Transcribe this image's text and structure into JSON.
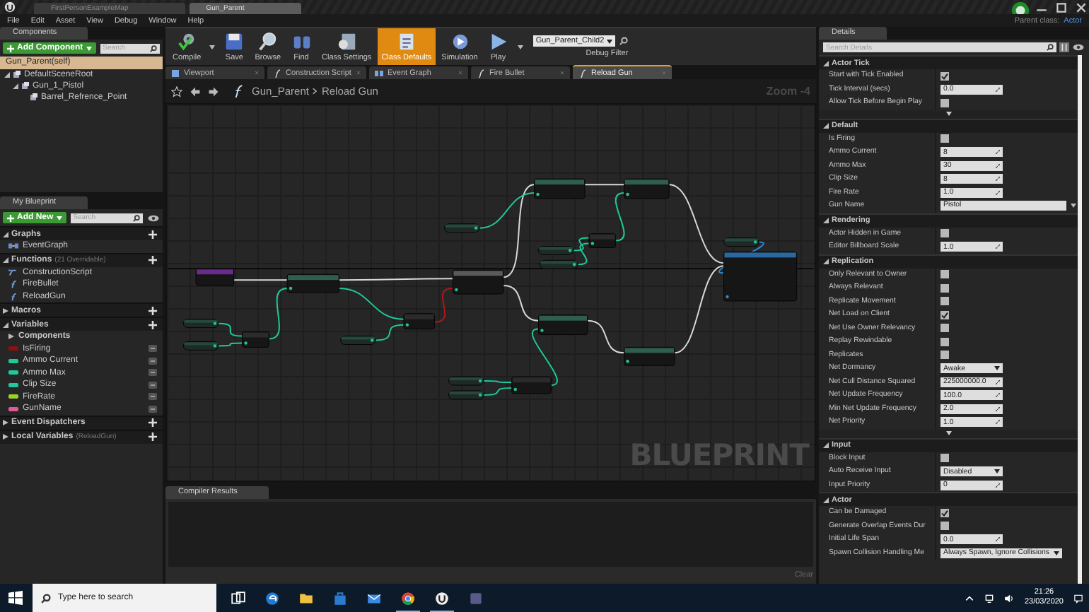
{
  "window": {
    "tabs": [
      {
        "label": "FirstPersonExampleMap",
        "selected": false
      },
      {
        "label": "Gun_Parent",
        "selected": true
      }
    ]
  },
  "menu": [
    "File",
    "Edit",
    "Asset",
    "View",
    "Debug",
    "Window",
    "Help"
  ],
  "parent_class": {
    "label": "Parent class:",
    "value": "Actor"
  },
  "components": {
    "title": "Components",
    "add_button": "Add Component",
    "search_placeholder": "Search",
    "self_row": {
      "label": "Gun_Parent(self)",
      "selected": true
    },
    "tree": [
      {
        "label": "DefaultSceneRoot",
        "expanded": true,
        "children": [
          {
            "label": "Gun_1_Pistol",
            "expanded": true,
            "children": [
              {
                "label": "Barrel_Refrence_Point"
              }
            ]
          }
        ]
      }
    ]
  },
  "my_blueprint": {
    "title": "My Blueprint",
    "add_button": "Add New",
    "search_placeholder": "Search",
    "sections": [
      {
        "label": "Graphs",
        "expanded": true,
        "items": [
          {
            "label": "EventGraph",
            "kind": "graph"
          }
        ]
      },
      {
        "label": "Functions",
        "note": "(21 Overridable)",
        "expanded": true,
        "items": [
          {
            "label": "ConstructionScript",
            "kind": "construction"
          },
          {
            "label": "FireBullet",
            "kind": "function"
          },
          {
            "label": "ReloadGun",
            "kind": "function"
          }
        ]
      },
      {
        "label": "Macros",
        "expanded": false
      },
      {
        "label": "Variables",
        "expanded": true,
        "items": [
          {
            "label": "Components",
            "kind": "category"
          },
          {
            "label": "IsFiring",
            "kind": "variable",
            "color": "#8c1010"
          },
          {
            "label": "Ammo Current",
            "kind": "variable",
            "color": "#1fc99a"
          },
          {
            "label": "Ammo Max",
            "kind": "variable",
            "color": "#1fc99a"
          },
          {
            "label": "Clip Size",
            "kind": "variable",
            "color": "#1fc99a"
          },
          {
            "label": "FireRate",
            "kind": "variable",
            "color": "#9ad12a"
          },
          {
            "label": "GunName",
            "kind": "variable",
            "color": "#e05a9a"
          }
        ]
      },
      {
        "label": "Event Dispatchers",
        "expanded": false
      },
      {
        "label": "Local Variables",
        "note": "(ReloadGun)",
        "expanded": false
      }
    ]
  },
  "toolbar": {
    "buttons": [
      {
        "label": "Compile",
        "kind": "compile",
        "selected": false,
        "menu": true
      },
      {
        "label": "Save",
        "kind": "save",
        "selected": false,
        "menu": false
      },
      {
        "label": "Browse",
        "kind": "browse",
        "selected": false,
        "menu": false
      },
      {
        "label": "Find",
        "kind": "find",
        "selected": false,
        "menu": false
      },
      {
        "label": "Class Settings",
        "kind": "settings",
        "selected": false,
        "menu": false
      },
      {
        "label": "Class Defaults",
        "kind": "defaults",
        "selected": true,
        "menu": false
      },
      {
        "label": "Simulation",
        "kind": "simulation",
        "selected": false,
        "menu": false
      },
      {
        "label": "Play",
        "kind": "play",
        "selected": false,
        "menu": true
      }
    ],
    "debug": {
      "value": "Gun_Parent_Child2",
      "label": "Debug Filter"
    }
  },
  "graph_tabs": [
    {
      "label": "Viewport",
      "kind": "viewport",
      "selected": false
    },
    {
      "label": "Construction Script",
      "kind": "function",
      "selected": false
    },
    {
      "label": "Event Graph",
      "kind": "graph",
      "selected": false
    },
    {
      "label": "Fire Bullet",
      "kind": "function",
      "selected": false
    },
    {
      "label": "Reload Gun",
      "kind": "function",
      "selected": true
    }
  ],
  "breadcrumb": {
    "root": "Gun_Parent",
    "current": "Reload Gun",
    "zoom": "Zoom -4"
  },
  "graph_badge": "BLUEPRINT",
  "compiler": {
    "title": "Compiler Results",
    "clear": "Clear"
  },
  "details": {
    "title": "Details",
    "search_placeholder": "Search Details",
    "sections": [
      {
        "label": "Actor Tick",
        "advanced": true,
        "rows": [
          {
            "label": "Start with Tick Enabled",
            "kind": "checkbox",
            "checked": true
          },
          {
            "label": "Tick Interval (secs)",
            "kind": "number",
            "value": "0.0"
          },
          {
            "label": "Allow Tick Before Begin Play",
            "kind": "checkbox",
            "checked": false
          }
        ]
      },
      {
        "label": "Default",
        "advanced": false,
        "rows": [
          {
            "label": "Is Firing",
            "kind": "checkbox",
            "checked": false
          },
          {
            "label": "Ammo Current",
            "kind": "number",
            "value": "8"
          },
          {
            "label": "Ammo Max",
            "kind": "number",
            "value": "30"
          },
          {
            "label": "Clip Size",
            "kind": "number",
            "value": "8"
          },
          {
            "label": "Fire Rate",
            "kind": "number",
            "value": "1.0"
          },
          {
            "label": "Gun Name",
            "kind": "text",
            "value": "Pistol"
          }
        ]
      },
      {
        "label": "Rendering",
        "advanced": false,
        "rows": [
          {
            "label": "Actor Hidden in Game",
            "kind": "checkbox",
            "checked": false
          },
          {
            "label": "Editor Billboard Scale",
            "kind": "number",
            "value": "1.0"
          }
        ]
      },
      {
        "label": "Replication",
        "advanced": true,
        "rows": [
          {
            "label": "Only Relevant to Owner",
            "kind": "checkbox",
            "checked": false
          },
          {
            "label": "Always Relevant",
            "kind": "checkbox",
            "checked": false
          },
          {
            "label": "Replicate Movement",
            "kind": "checkbox",
            "checked": false
          },
          {
            "label": "Net Load on Client",
            "kind": "checkbox",
            "checked": true
          },
          {
            "label": "Net Use Owner Relevancy",
            "kind": "checkbox",
            "checked": false
          },
          {
            "label": "Replay Rewindable",
            "kind": "checkbox",
            "checked": false
          },
          {
            "label": "Replicates",
            "kind": "checkbox",
            "checked": false
          },
          {
            "label": "Net Dormancy",
            "kind": "dropdown",
            "value": "Awake"
          },
          {
            "label": "Net Cull Distance Squared",
            "kind": "number",
            "value": "225000000.0"
          },
          {
            "label": "Net Update Frequency",
            "kind": "number",
            "value": "100.0"
          },
          {
            "label": "Min Net Update Frequency",
            "kind": "number",
            "value": "2.0"
          },
          {
            "label": "Net Priority",
            "kind": "number",
            "value": "1.0"
          }
        ]
      },
      {
        "label": "Input",
        "advanced": false,
        "rows": [
          {
            "label": "Block Input",
            "kind": "checkbox",
            "checked": false
          },
          {
            "label": "Auto Receive Input",
            "kind": "dropdown",
            "value": "Disabled"
          },
          {
            "label": "Input Priority",
            "kind": "number",
            "value": "0"
          }
        ]
      },
      {
        "label": "Actor",
        "advanced": false,
        "rows": [
          {
            "label": "Can be Damaged",
            "kind": "checkbox",
            "checked": true
          },
          {
            "label": "Generate Overlap Events Dur",
            "kind": "checkbox",
            "checked": false
          },
          {
            "label": "Initial Life Span",
            "kind": "number",
            "value": "0.0"
          },
          {
            "label": "Spawn Collision Handling Me",
            "kind": "dropdown",
            "value": "Always Spawn, Ignore Collisions"
          }
        ]
      }
    ]
  },
  "taskbar": {
    "search_placeholder": "Type here to search",
    "time": "21:26",
    "date": "23/03/2020"
  }
}
